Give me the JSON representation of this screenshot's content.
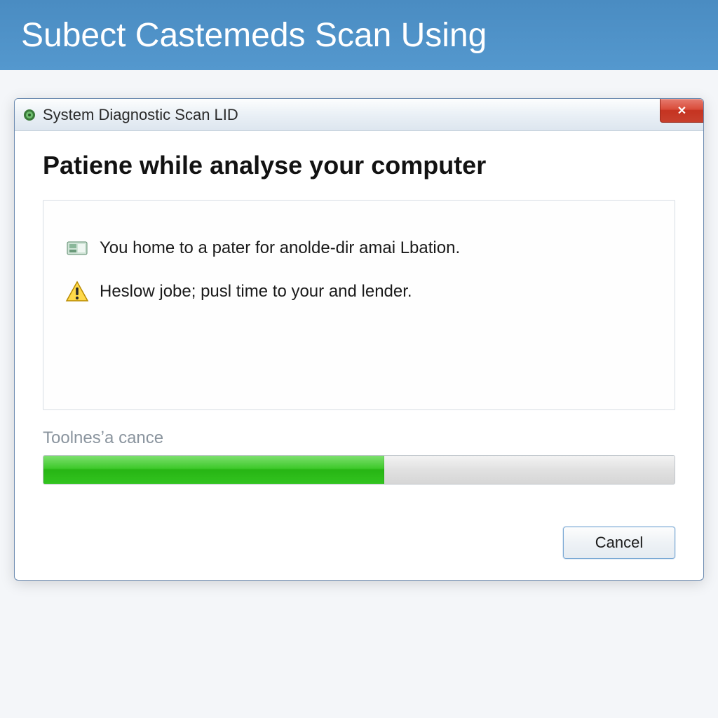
{
  "banner": {
    "title": "Subect Castemeds Scan Using"
  },
  "dialog": {
    "title": "System Diagnostic Scan LID",
    "close_glyph": "✕",
    "heading": "Patiene while analyse your computer",
    "rows": [
      {
        "icon": "disk-icon",
        "text": "You home to a pater for anolde-dir amai Lbation."
      },
      {
        "icon": "warning-icon",
        "text": "Heslow jobe; pusl time to your and lender."
      }
    ],
    "progress": {
      "label": "Toolnesʼa cance",
      "percent": 54
    },
    "cancel_label": "Cancel"
  },
  "colors": {
    "banner_bg": "#4c8fc4",
    "progress_green": "#27b514",
    "close_red": "#c53321"
  }
}
